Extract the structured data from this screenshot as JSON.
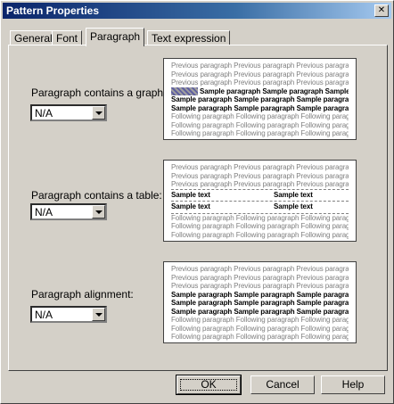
{
  "window": {
    "title": "Pattern Properties",
    "close_glyph": "✕"
  },
  "tabs": [
    "General",
    "Font",
    "Paragraph",
    "Text expression"
  ],
  "active_tab": "Paragraph",
  "rows": [
    {
      "label": "Paragraph contains a graphic:",
      "value": "N/A"
    },
    {
      "label": "Paragraph contains a table:",
      "value": "N/A"
    },
    {
      "label": "Paragraph alignment:",
      "value": "N/A"
    }
  ],
  "preview": {
    "previous": "Previous paragraph Previous paragraph Previous paragraph",
    "following": "Following paragraph Following paragraph Following paragraph",
    "sample": "Sample paragraph Sample paragraph Sample paragraph",
    "sample_text": "Sample text"
  },
  "buttons": {
    "ok": "OK",
    "cancel": "Cancel",
    "help": "Help"
  }
}
